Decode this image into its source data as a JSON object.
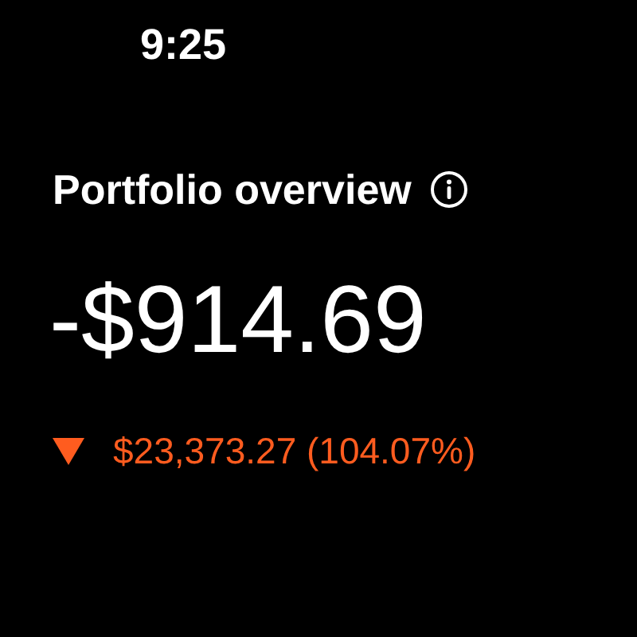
{
  "status_bar": {
    "time": "9:25"
  },
  "header": {
    "title": "Portfolio overview"
  },
  "balance": "-$914.69",
  "change": {
    "falling": true,
    "text": "$23,373.27 (104.07%)"
  }
}
